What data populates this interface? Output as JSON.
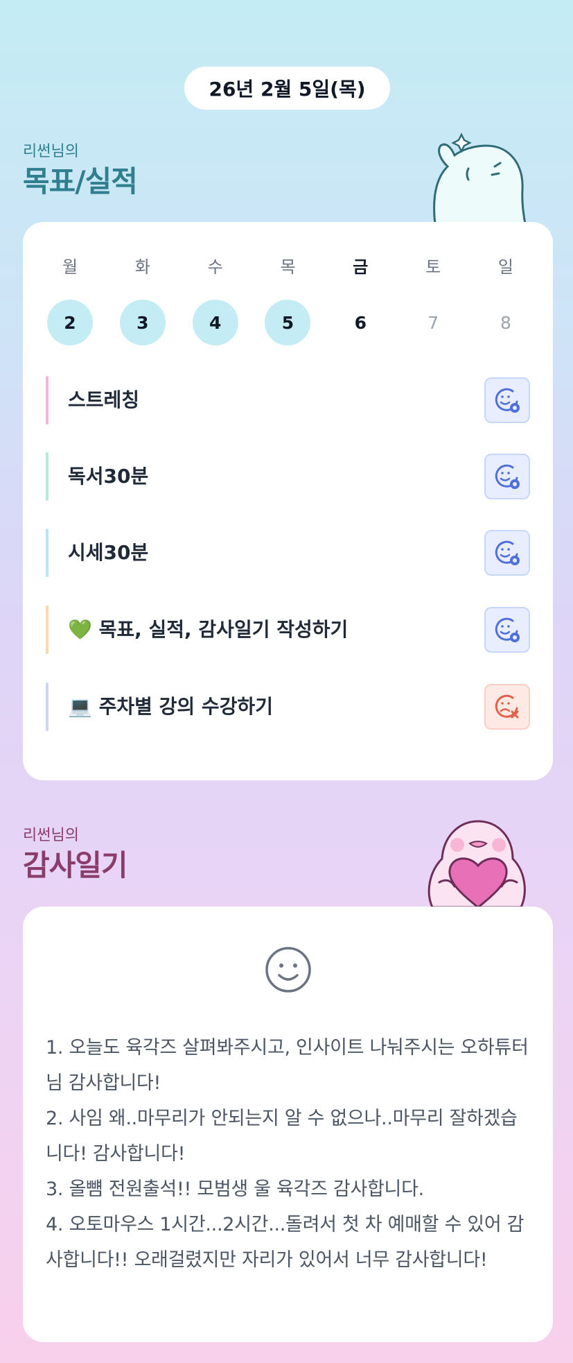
{
  "date": "26년 2월 5일(목)",
  "goals_section": {
    "subtitle": "리썬님의",
    "title": "목표/실적",
    "week": [
      {
        "name": "월",
        "num": "2",
        "state": "done"
      },
      {
        "name": "화",
        "num": "3",
        "state": "done"
      },
      {
        "name": "수",
        "num": "4",
        "state": "done"
      },
      {
        "name": "목",
        "num": "5",
        "state": "done"
      },
      {
        "name": "금",
        "num": "6",
        "state": "today"
      },
      {
        "name": "토",
        "num": "7",
        "state": "future"
      },
      {
        "name": "일",
        "num": "8",
        "state": "future"
      }
    ],
    "items": [
      {
        "label": "스트레칭",
        "bar_color": "#f2b6d9",
        "status": "done",
        "status_icon": "smile-check-icon"
      },
      {
        "label": "독서30분",
        "bar_color": "#b9ead8",
        "status": "done",
        "status_icon": "smile-check-icon"
      },
      {
        "label": "시세30분",
        "bar_color": "#bfe3f6",
        "status": "done",
        "status_icon": "smile-check-icon"
      },
      {
        "label": "💚 목표, 실적, 감사일기 작성하기",
        "bar_color": "#f9d8b2",
        "status": "done",
        "status_icon": "smile-check-icon"
      },
      {
        "label": "💻 주차별 강의 수강하기",
        "bar_color": "#cfd6f2",
        "status": "fail",
        "status_icon": "smile-x-icon"
      }
    ]
  },
  "diary_section": {
    "subtitle": "리썬님의",
    "title": "감사일기",
    "mood_icon": "smile-face-icon",
    "lines": [
      "1. 오늘도 육각즈 살펴봐주시고, 인사이트 나눠주시는 오하튜터님 감사합니다!",
      "2. 사임 왜..마무리가 안되는지 알 수 없으나..마무리 잘하겠습니다! 감사합니다!",
      "3. 올뻄 전원출석!! 모범생 울 육각즈 감사합니다.",
      "4. 오토마우스 1시간...2시간...돌려서 첫 차 예매할 수 있어 감사합니다!! 오래걸렸지만 자리가 있어서 너무 감사합니다!"
    ]
  },
  "colors": {
    "accent_teal": "#2f7f8e",
    "accent_plum": "#8a3d6b",
    "done_day": "#c4ecf4",
    "ok_icon": "#4f6fdc",
    "fail_icon": "#e2604a"
  }
}
